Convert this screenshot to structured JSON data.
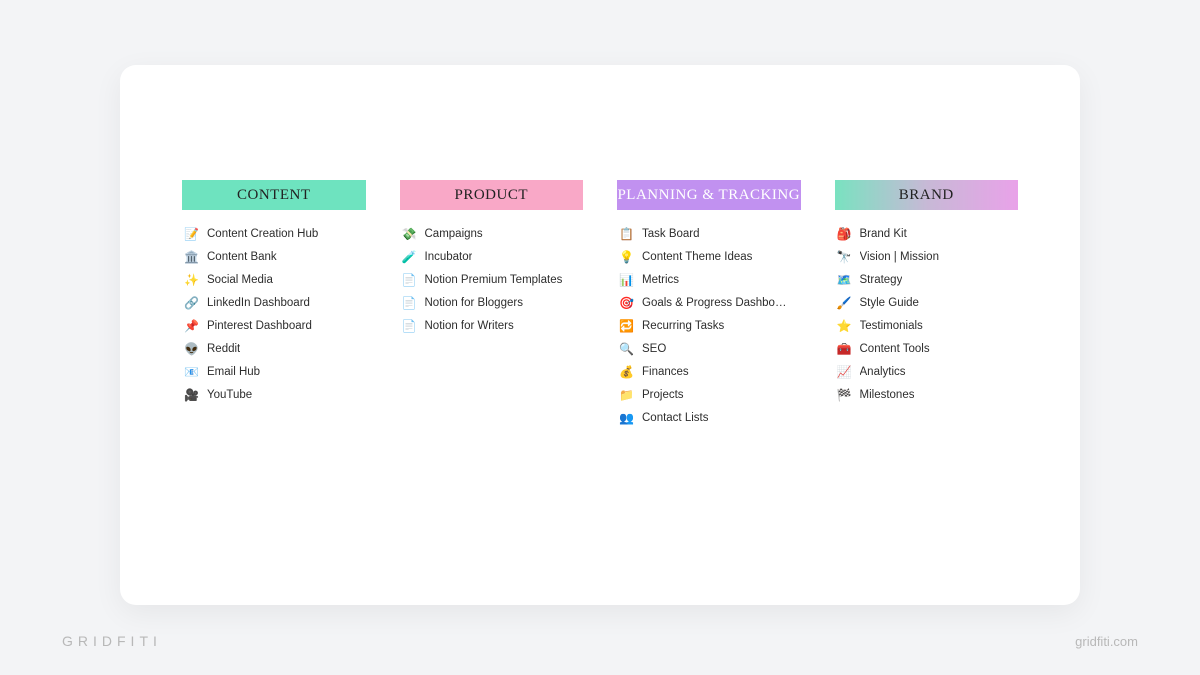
{
  "watermark_left": "GRIDFITI",
  "watermark_right": "gridfiti.com",
  "columns": [
    {
      "header": "CONTENT",
      "items": [
        {
          "icon": "📝",
          "label": "Content Creation Hub"
        },
        {
          "icon": "🏛️",
          "label": "Content Bank"
        },
        {
          "icon": "✨",
          "label": "Social Media"
        },
        {
          "icon": "🔗",
          "label": "LinkedIn Dashboard"
        },
        {
          "icon": "📌",
          "label": "Pinterest Dashboard"
        },
        {
          "icon": "👽",
          "label": "Reddit"
        },
        {
          "icon": "📧",
          "label": "Email Hub"
        },
        {
          "icon": "🎥",
          "label": "YouTube"
        }
      ]
    },
    {
      "header": "PRODUCT",
      "items": [
        {
          "icon": "💸",
          "label": "Campaigns"
        },
        {
          "icon": "🧪",
          "label": "Incubator"
        },
        {
          "icon": "📄",
          "label": "Notion Premium Templates"
        },
        {
          "icon": "📄",
          "label": "Notion for Bloggers"
        },
        {
          "icon": "📄",
          "label": "Notion for Writers"
        }
      ]
    },
    {
      "header": "PLANNING & TRACKING",
      "items": [
        {
          "icon": "📋",
          "label": "Task Board"
        },
        {
          "icon": "💡",
          "label": "Content Theme Ideas"
        },
        {
          "icon": "📊",
          "label": "Metrics"
        },
        {
          "icon": "🎯",
          "label": "Goals & Progress Dashbo…"
        },
        {
          "icon": "🔁",
          "label": "Recurring Tasks"
        },
        {
          "icon": "🔍",
          "label": "SEO"
        },
        {
          "icon": "💰",
          "label": "Finances"
        },
        {
          "icon": "📁",
          "label": "Projects"
        },
        {
          "icon": "👥",
          "label": "Contact Lists"
        }
      ]
    },
    {
      "header": "BRAND",
      "items": [
        {
          "icon": "🎒",
          "label": "Brand Kit"
        },
        {
          "icon": "🔭",
          "label": "Vision | Mission"
        },
        {
          "icon": "🗺️",
          "label": "Strategy"
        },
        {
          "icon": "🖌️",
          "label": "Style Guide"
        },
        {
          "icon": "⭐",
          "label": "Testimonials"
        },
        {
          "icon": "🧰",
          "label": "Content Tools"
        },
        {
          "icon": "📈",
          "label": "Analytics"
        },
        {
          "icon": "🏁",
          "label": "Milestones"
        }
      ]
    }
  ]
}
